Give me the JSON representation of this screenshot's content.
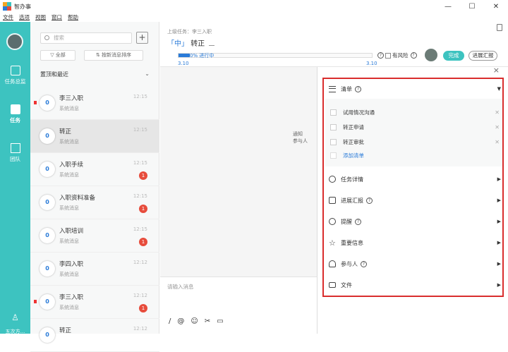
{
  "window": {
    "title": "智办事",
    "minimize": "—",
    "maximize": "☐",
    "close": "✕"
  },
  "menu": [
    "文件",
    "选项",
    "视图",
    "窗口",
    "帮助"
  ],
  "nav": {
    "items": [
      {
        "label": "任务总监"
      },
      {
        "label": "任务",
        "active": true
      },
      {
        "label": "团队"
      }
    ],
    "bottom_label": "五次方..."
  },
  "list": {
    "search_placeholder": "搜索",
    "add": "+",
    "filter_all": "全部",
    "sort": "按新消息排序",
    "group_title": "置顶和最近",
    "items": [
      {
        "count": "0",
        "name": "李三入职",
        "sub": "系统消息",
        "time": "12:15",
        "unread": "",
        "flag": true
      },
      {
        "count": "0",
        "name": "转正",
        "sub": "系统消息",
        "time": "12:15",
        "unread": "",
        "flag": false
      },
      {
        "count": "0",
        "name": "入职手续",
        "sub": "系统消息",
        "time": "12:15",
        "unread": "1",
        "flag": false
      },
      {
        "count": "0",
        "name": "入职资料准备",
        "sub": "系统消息",
        "time": "12:15",
        "unread": "1",
        "flag": false
      },
      {
        "count": "0",
        "name": "入职培训",
        "sub": "系统消息",
        "time": "12:15",
        "unread": "1",
        "flag": false
      },
      {
        "count": "0",
        "name": "李四入职",
        "sub": "系统消息",
        "time": "12:12",
        "unread": "",
        "flag": false
      },
      {
        "count": "0",
        "name": "李三入职",
        "sub": "系统消息",
        "time": "12:12",
        "unread": "1",
        "flag": true
      },
      {
        "count": "0",
        "name": "转正",
        "sub": "",
        "time": "12:12",
        "unread": "",
        "flag": false
      }
    ]
  },
  "task": {
    "parent": "上级任务：李三入职",
    "priority": "「中」",
    "title": "转正",
    "progress_text": "0% 进行中",
    "progress_pct": 6,
    "start_date": "3.10",
    "end_date": "3.10",
    "risk_label": "有风险",
    "done_button": "完成",
    "report_button": "进展汇报",
    "clipped_line1": "通知",
    "clipped_line2": "参与人"
  },
  "input": {
    "placeholder": "请输入消息",
    "tools": [
      "/",
      "@",
      "☺",
      "✂",
      "▭"
    ]
  },
  "panel": {
    "close": "×",
    "checklist_title": "清单",
    "checklist_items": [
      "试用情况沟通",
      "转正申请",
      "转正审批"
    ],
    "add_item": "添加清单",
    "sections": [
      "任务详情",
      "进展汇报",
      "提醒",
      "重要信息",
      "参与人",
      "文件"
    ]
  },
  "colors": {
    "teal": "#3dc3c0",
    "blue": "#2a7bd8",
    "red_badge": "#e74c3c",
    "highlight_box": "#d92d2d"
  }
}
